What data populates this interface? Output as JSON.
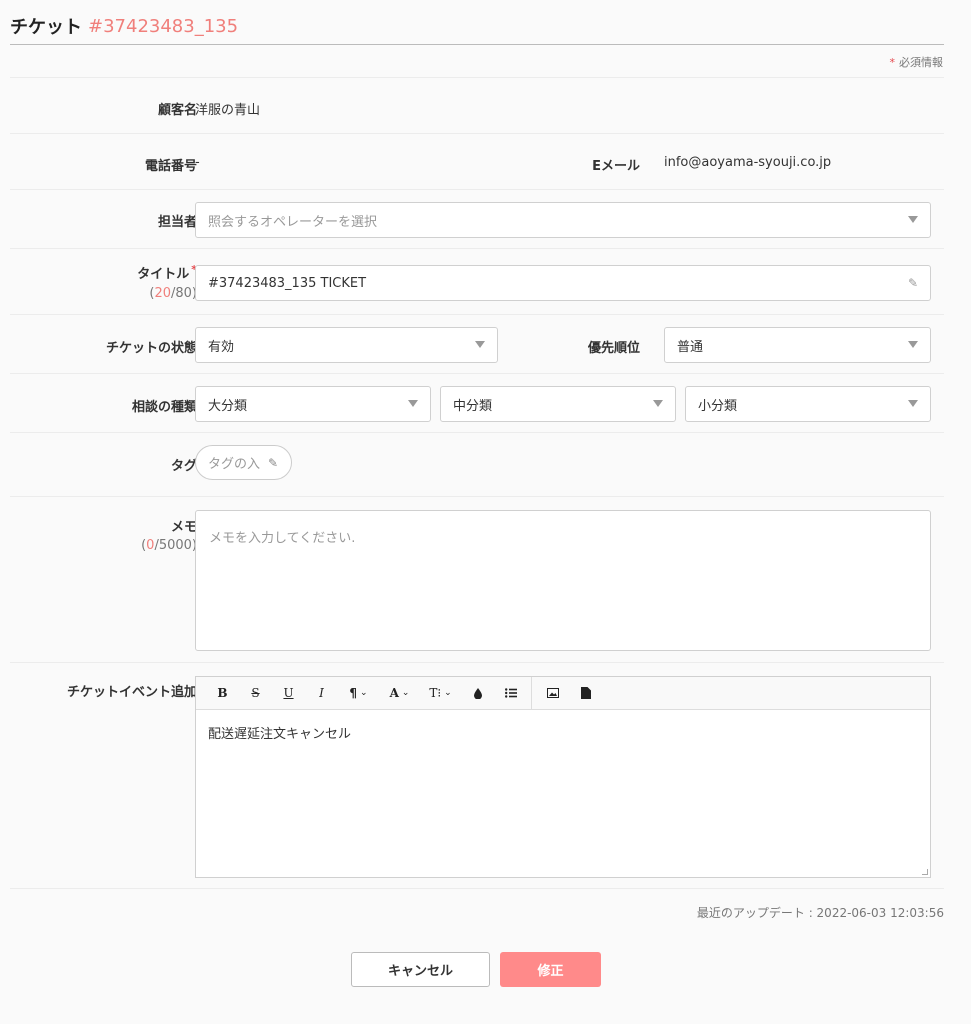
{
  "header": {
    "title": "チケット",
    "ticket_id": "#37423483_135"
  },
  "required_note": "必須情報",
  "required_star": "*",
  "form": {
    "customer": {
      "label": "顧客名",
      "value": "洋服の青山"
    },
    "phone": {
      "label": "電話番号",
      "value": "-"
    },
    "email": {
      "label": "Eメール",
      "value": "info@aoyama-syouji.co.jp"
    },
    "assignee": {
      "label": "担当者",
      "placeholder": "照会するオペレーターを選択"
    },
    "title": {
      "label": "タイトル",
      "required": "*",
      "count_open": "(",
      "count": "20",
      "count_rest": "/80)",
      "value": "#37423483_135 TICKET"
    },
    "status": {
      "label": "チケットの状態",
      "value": "有効"
    },
    "priority": {
      "label": "優先順位",
      "value": "普通"
    },
    "category": {
      "label": "相談の種類",
      "large": "大分類",
      "medium": "中分類",
      "small": "小分類"
    },
    "tag": {
      "label": "タグ",
      "placeholder": "タグの入"
    },
    "memo": {
      "label": "メモ",
      "count_open": "(",
      "count": "0",
      "count_rest": "/5000)",
      "placeholder": "メモを入力してください."
    },
    "event": {
      "label": "チケットイベント追加",
      "toolbar": {
        "bold": "B",
        "strike": "S",
        "underline": "U",
        "italic": "I",
        "paragraph": "¶",
        "font_color": "A",
        "font_size": "T⁝",
        "chevron": "⌄",
        "ink": "💧",
        "list": "☰",
        "image": "▣",
        "file": "▤"
      },
      "content": "配送遅延注文キャンセル"
    }
  },
  "last_updated": "最近のアップデート : 2022-06-03 12:03:56",
  "buttons": {
    "cancel": "キャンセル",
    "submit": "修正"
  },
  "colors": {
    "accent": "#f07f7b",
    "submit_bg": "#ff8a8a",
    "required": "#e5484d"
  }
}
